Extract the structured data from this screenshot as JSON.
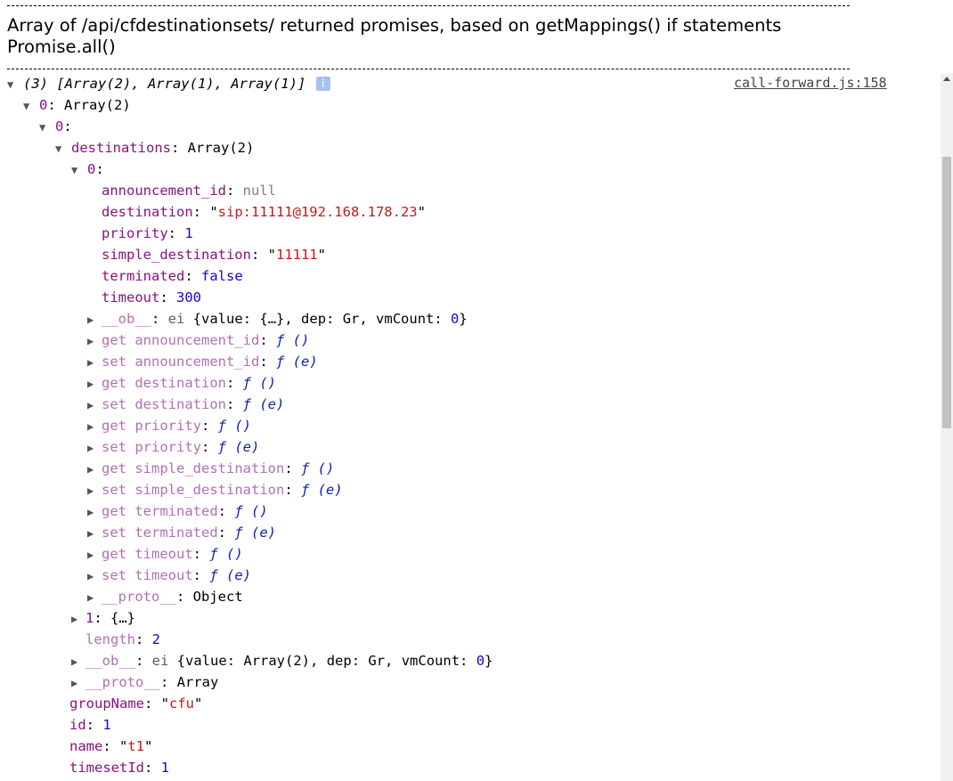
{
  "header": {
    "dashes": "--------------------------------------------------------------------------------------------------------------------------",
    "line1": "Array of /api/cfdestinationsets/ returned promises, based on getMappings() if statements",
    "line2": "Promise.all()"
  },
  "console": {
    "source_link": "call-forward.js:158",
    "summary": "(3) [Array(2), Array(1), Array(1)]",
    "info_glyph": "i",
    "root0_key": "0",
    "root0_val": "Array(2)",
    "item0_key": "0",
    "destinations_key": "destinations",
    "destinations_val": "Array(2)",
    "dest0_key": "0",
    "props": [
      {
        "key": "announcement_id",
        "val": "null"
      },
      {
        "key": "destination",
        "val": "sip:11111@192.168.178.23"
      },
      {
        "key": "priority",
        "val": "1"
      },
      {
        "key": "simple_destination",
        "val": "11111"
      },
      {
        "key": "terminated",
        "val": "false"
      },
      {
        "key": "timeout",
        "val": "300"
      }
    ],
    "ob_inner": {
      "key": "__ob__",
      "type": "ei",
      "value_key": "value",
      "value_val": "{…}",
      "dep_key": "dep",
      "dep_val": "Gr",
      "vm_key": "vmCount",
      "vm_val": "0"
    },
    "accessors": [
      {
        "kind": "get",
        "name": "announcement_id",
        "fn": "ƒ ()"
      },
      {
        "kind": "set",
        "name": "announcement_id",
        "fn": "ƒ (e)"
      },
      {
        "kind": "get",
        "name": "destination",
        "fn": "ƒ ()"
      },
      {
        "kind": "set",
        "name": "destination",
        "fn": "ƒ (e)"
      },
      {
        "kind": "get",
        "name": "priority",
        "fn": "ƒ ()"
      },
      {
        "kind": "set",
        "name": "priority",
        "fn": "ƒ (e)"
      },
      {
        "kind": "get",
        "name": "simple_destination",
        "fn": "ƒ ()"
      },
      {
        "kind": "set",
        "name": "simple_destination",
        "fn": "ƒ (e)"
      },
      {
        "kind": "get",
        "name": "terminated",
        "fn": "ƒ ()"
      },
      {
        "kind": "set",
        "name": "terminated",
        "fn": "ƒ (e)"
      },
      {
        "kind": "get",
        "name": "timeout",
        "fn": "ƒ ()"
      },
      {
        "kind": "set",
        "name": "timeout",
        "fn": "ƒ (e)"
      }
    ],
    "proto_inner": {
      "key": "__proto__",
      "val": "Object"
    },
    "dest1": {
      "key": "1",
      "val": "{…}"
    },
    "length": {
      "key": "length",
      "val": "2"
    },
    "ob_outer": {
      "key": "__ob__",
      "type": "ei",
      "value_key": "value",
      "value_val": "Array(2)",
      "dep_key": "dep",
      "dep_val": "Gr",
      "vm_key": "vmCount",
      "vm_val": "0"
    },
    "proto_outer": {
      "key": "__proto__",
      "val": "Array"
    },
    "tail": [
      {
        "key": "groupName",
        "val": "cfu",
        "is_string": true
      },
      {
        "key": "id",
        "val": "1"
      },
      {
        "key": "name",
        "val": "t1",
        "is_string": true
      },
      {
        "key": "timesetId",
        "val": "1"
      }
    ]
  },
  "colors": {
    "key": "#881280",
    "string": "#c41a16",
    "number": "#1c00cf",
    "null": "#808080",
    "function": "#0d22aa"
  }
}
